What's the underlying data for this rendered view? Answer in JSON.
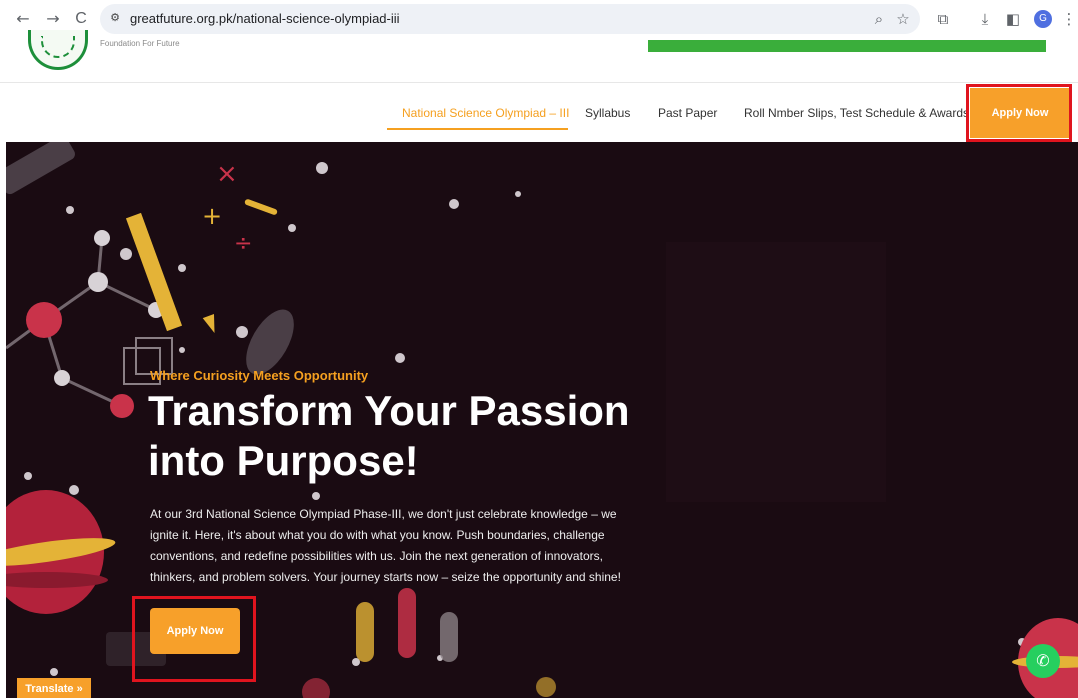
{
  "browser": {
    "url": "greatfuture.org.pk/national-science-olympiad-iii",
    "avatar_initial": "G",
    "icons": {
      "back": "←",
      "forward": "→",
      "reload": "C",
      "site_info": "⚙",
      "zoom": "⌕",
      "bookmark": "☆",
      "extensions": "⧉",
      "download": "⤓",
      "sidebar": "◧",
      "menu": "⋮"
    }
  },
  "header": {
    "tagline": "Foundation For Future"
  },
  "nav": {
    "items": [
      {
        "label": "National Science Olympiad – III"
      },
      {
        "label": "Syllabus"
      },
      {
        "label": "Past Paper"
      },
      {
        "label": "Roll Nmber Slips, Test Schedule & Awards"
      }
    ],
    "apply_label": "Apply Now"
  },
  "hero": {
    "eyebrow": "Where Curiosity Meets Opportunity",
    "headline_line1": "Transform Your Passion",
    "headline_line2": "into Purpose!",
    "description": "At our 3rd National Science Olympiad Phase-III, we don't just celebrate knowledge – we ignite it. Here, it's about what you do with what you know. Push boundaries, challenge conventions, and redefine possibilities with us. Join the next generation of innovators, thinkers, and problem solvers. Your journey starts now – seize the opportunity and shine!",
    "apply_label": "Apply Now"
  },
  "widgets": {
    "translate_label": "Translate »",
    "whatsapp_icon": "✆"
  },
  "colors": {
    "accent": "#f7a02a",
    "hero_bg": "#1a0b12",
    "highlight_box": "#e0141e",
    "green_bar": "#3aae3b"
  }
}
